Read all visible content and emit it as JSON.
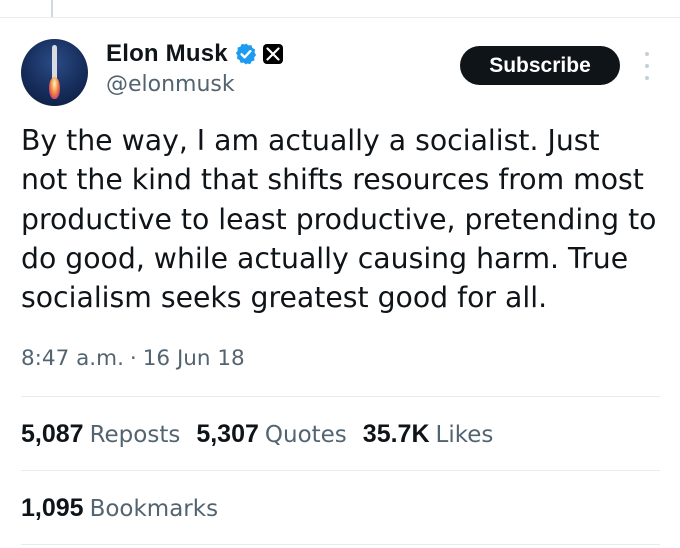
{
  "author": {
    "name": "Elon Musk",
    "handle": "@elonmusk"
  },
  "actions": {
    "subscribe_label": "Subscribe"
  },
  "tweet": {
    "text": "By the way, I am actually a socialist. Just\nnot the kind that shifts resources from most\nproductive to least productive, pretending to\ndo good, while actually causing harm. True\nsocialism seeks greatest good for all.",
    "time": "8:47 a.m.",
    "separator": "·",
    "date": "16 Jun 18"
  },
  "stats": {
    "reposts_count": "5,087",
    "reposts_label": "Reposts",
    "quotes_count": "5,307",
    "quotes_label": "Quotes",
    "likes_count": "35.7K",
    "likes_label": "Likes",
    "bookmarks_count": "1,095",
    "bookmarks_label": "Bookmarks"
  },
  "colors": {
    "text": "#0f1419",
    "secondary_text": "#536471",
    "verified_blue": "#1d9bf0",
    "button_bg": "#0f1419",
    "divider": "#e7ecef"
  },
  "icons": [
    "verified-badge-icon",
    "x-logo-icon",
    "more-options-icon"
  ]
}
